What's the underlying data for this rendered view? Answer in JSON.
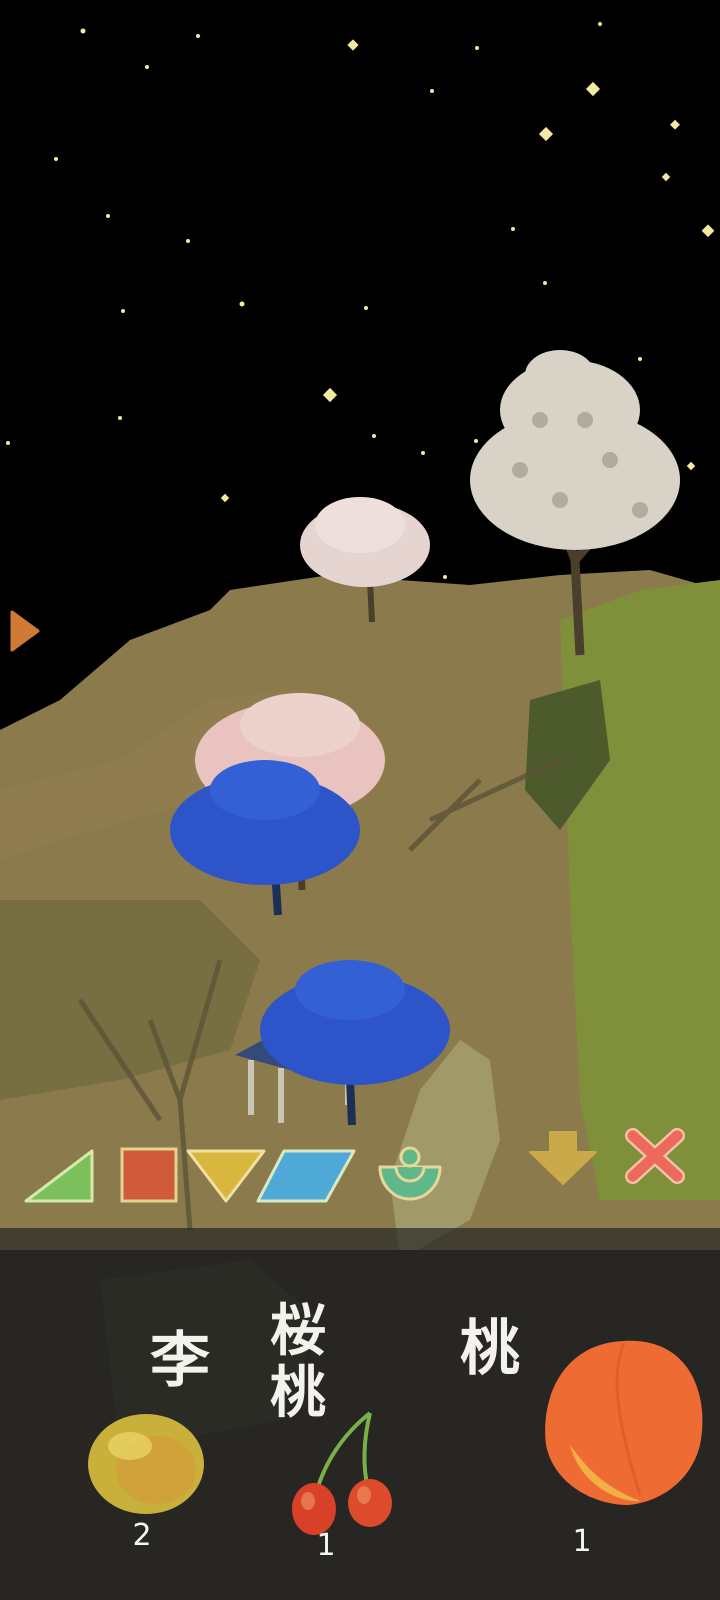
{
  "scene": {
    "colors": {
      "sky": "#000000",
      "star": "#f3e9a0",
      "hill": "#8a7a4c",
      "cliff": "#7f8f3a",
      "blue_tree": "#2d54c8",
      "pink_tree": "#e8c3bf",
      "white_tree": "#d8d3c6"
    }
  },
  "toolbar": {
    "tools": [
      {
        "name": "triangle",
        "icon": "green-triangle-icon",
        "color": "#7cc05b"
      },
      {
        "name": "square",
        "icon": "red-square-icon",
        "color": "#cf5a3c"
      },
      {
        "name": "inverted-triangle",
        "icon": "yellow-inverted-triangle-icon",
        "color": "#d9b73e"
      },
      {
        "name": "parallelogram",
        "icon": "blue-parallelogram-icon",
        "color": "#4fa9d6"
      },
      {
        "name": "seed",
        "icon": "green-seed-icon",
        "color": "#5fb889"
      },
      {
        "name": "down",
        "icon": "down-arrow-icon",
        "color": "#c9a94a"
      },
      {
        "name": "close",
        "icon": "close-x-icon",
        "color": "#ec6a5c"
      }
    ]
  },
  "fruits": [
    {
      "name": "李",
      "count": "2",
      "icon": "plum-icon"
    },
    {
      "name": "桜桃",
      "count": "1",
      "icon": "cherry-icon"
    },
    {
      "name": "桃",
      "count": "1",
      "icon": "peach-icon"
    }
  ]
}
